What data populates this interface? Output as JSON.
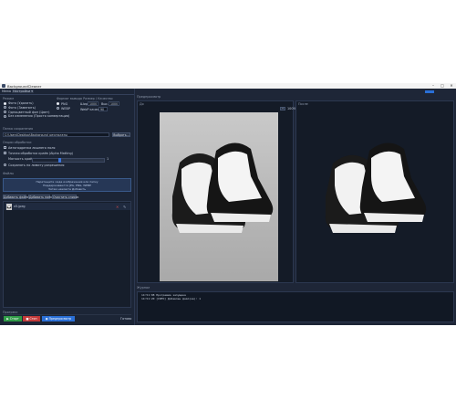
{
  "window": {
    "title": "BackgroundCleaner",
    "minimize": "–",
    "maximize": "□",
    "close": "✕"
  },
  "tabs": [
    "Меню",
    "Настройки ▾"
  ],
  "mode": {
    "header": "Режим",
    "options": [
      "Фото (Удалить)",
      "Фото (Заменить)",
      "Одноцветный фон (Цвет)",
      "Без изменения (Просто конвертация)"
    ],
    "selected_index": 0
  },
  "format": {
    "header": "Формат вывода   Размер / Качество",
    "options": [
      "PNG",
      "WEBP"
    ],
    "selected_index": 0,
    "width_label": "Шир.",
    "width_value": "1000",
    "height_label": "Выс.",
    "height_value": "1000",
    "quality_label": "WebP качество",
    "quality_value": "90"
  },
  "output_folder": {
    "header": "Папка сохранения",
    "path": "C:\\Users\\Desktop\\Background_результаты",
    "browse": "Выбрать..."
  },
  "processing": {
    "header": "Опции обработки",
    "checks": [
      "Автоподрезка лишнего поля",
      "Точная обработка краёв (Alpha Matting)"
    ],
    "edge_label": "Мягкость краёв",
    "edge_value": "1",
    "edge_fraction": 0.38,
    "save_same": "Сохранять по лимиту разрешения"
  },
  "files": {
    "header": "Файлы",
    "drop_lines": [
      "Перетащите сюда изображения или папку",
      "Поддерживаются JPG, PNG, WEBP",
      "Затем нажмите Добавить"
    ],
    "buttons": [
      "Добавить файлы",
      "Добавить папку",
      "Очистить список"
    ],
    "items": [
      {
        "name": "x5.jpeg"
      }
    ]
  },
  "progress": {
    "label": "Прогресс"
  },
  "actions": {
    "start": "▶ Старт",
    "stop": "■ Стоп",
    "preview": "◉ Предпросмотр",
    "status": "Готово"
  },
  "preview": {
    "header": "Предпросмотр",
    "before_label": "До",
    "after_label": "После",
    "zoom": "100%",
    "zoom_minus": "−"
  },
  "log": {
    "header": "Журнал",
    "lines": [
      "14:51:08  Программа запущена",
      "14:51:20  [INFO] Добавлен файл(ов): 1"
    ]
  },
  "colors": {
    "accent": "#2a6fd6",
    "start": "#2f9a47",
    "stop": "#c23a3a",
    "panel": "#1b2332"
  }
}
